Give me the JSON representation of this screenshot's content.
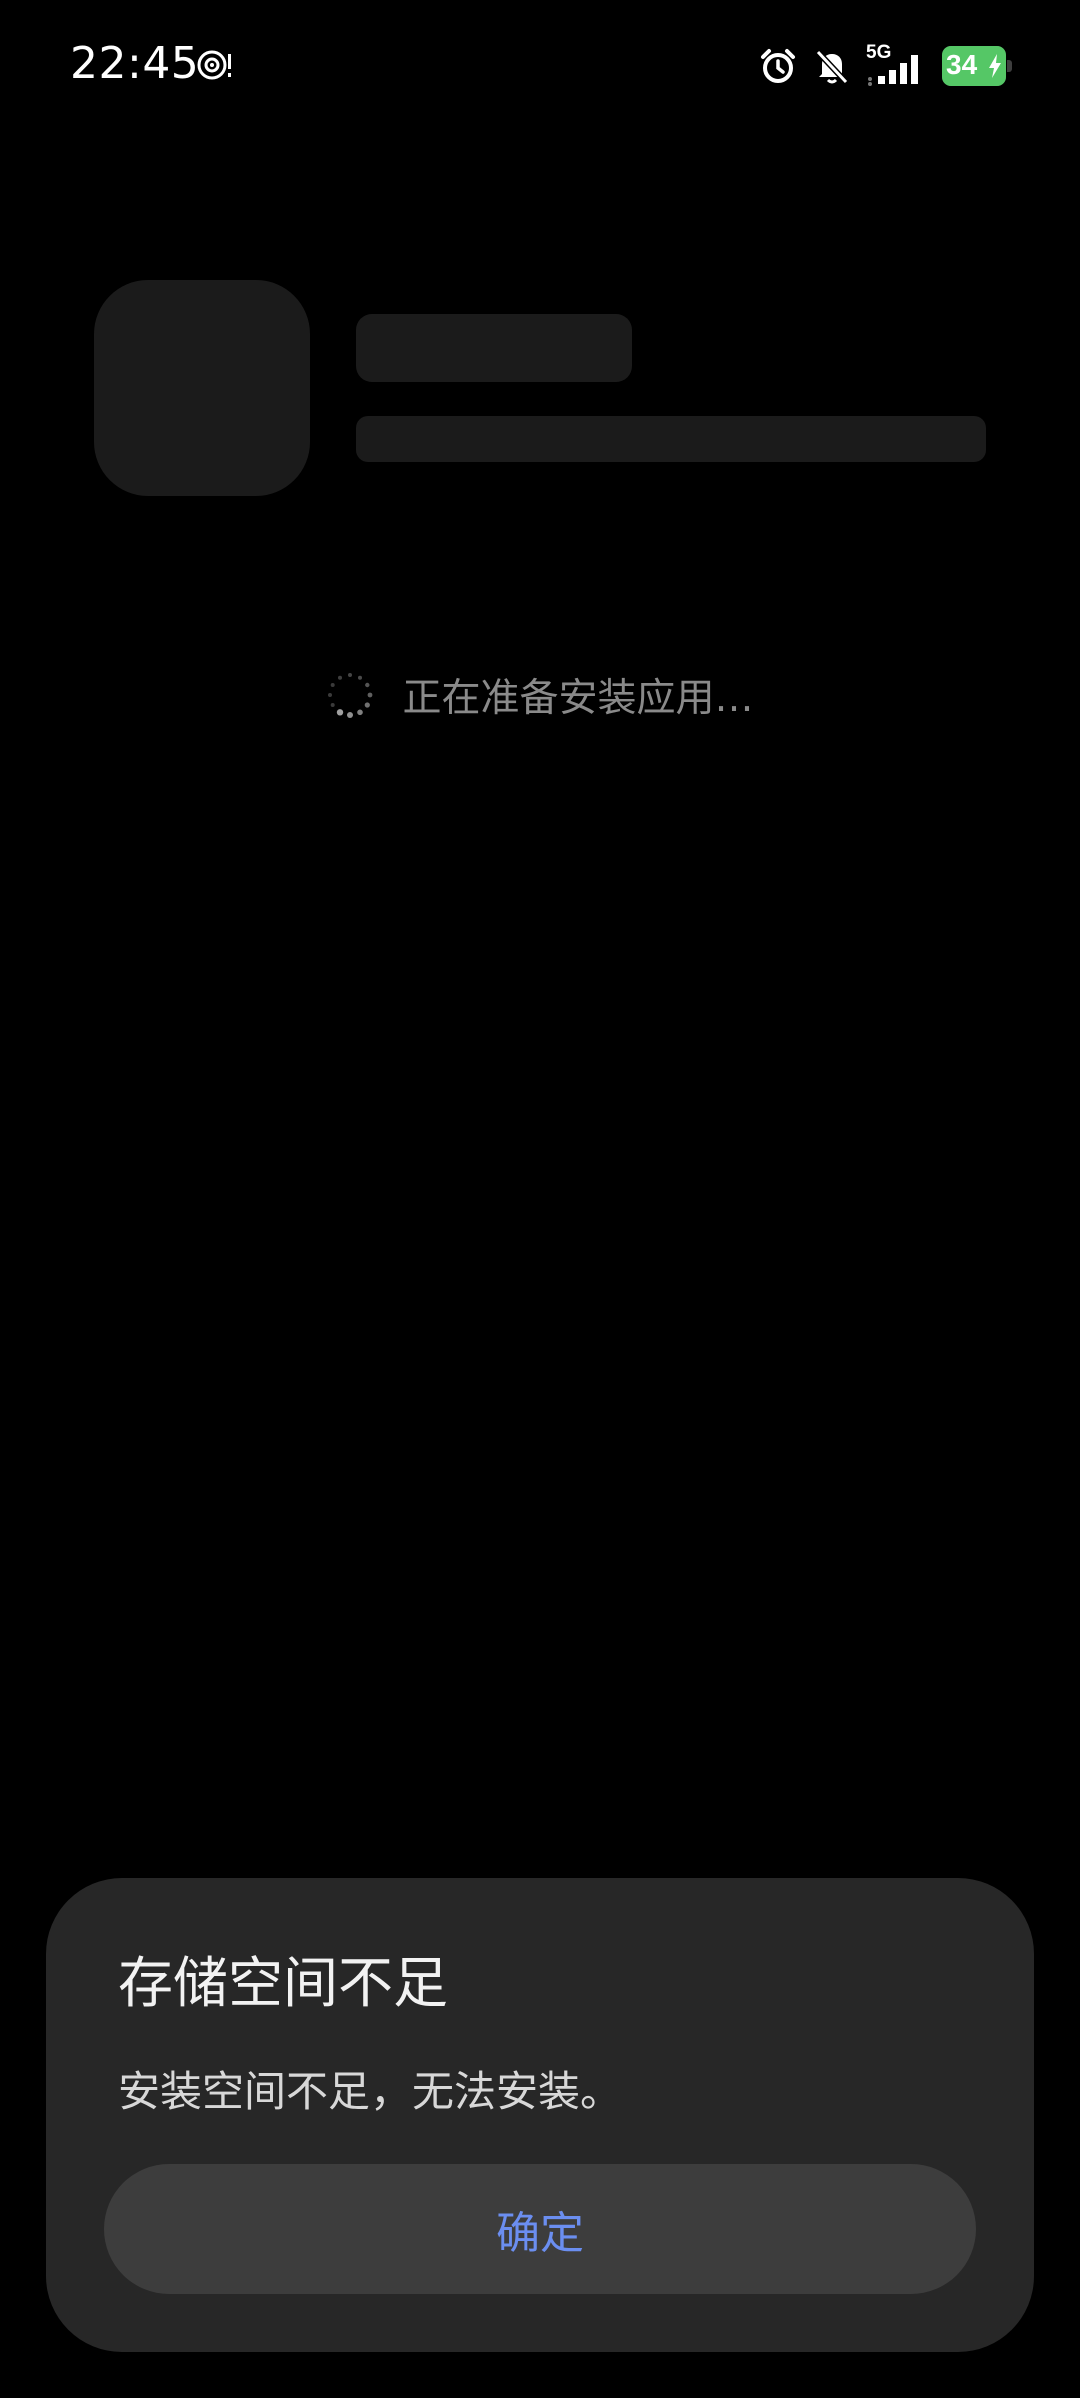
{
  "status_bar": {
    "time": "22:45",
    "network": "5G",
    "battery_percent": "34",
    "battery_level": 0.34,
    "icons": [
      "hotspot-icon",
      "alarm-icon",
      "bell-muted-icon",
      "signal-icon",
      "battery-icon",
      "charging-bolt-icon"
    ]
  },
  "installer": {
    "status_text": "正在准备安装应用…"
  },
  "dialog": {
    "title": "存储空间不足",
    "message": "安装空间不足，无法安装。",
    "confirm_label": "确定"
  },
  "colors": {
    "background": "#000000",
    "dialog_background": "#272727",
    "button_background": "#3d3d3d",
    "accent": "#6b8ef0",
    "battery_green": "#55c766"
  }
}
